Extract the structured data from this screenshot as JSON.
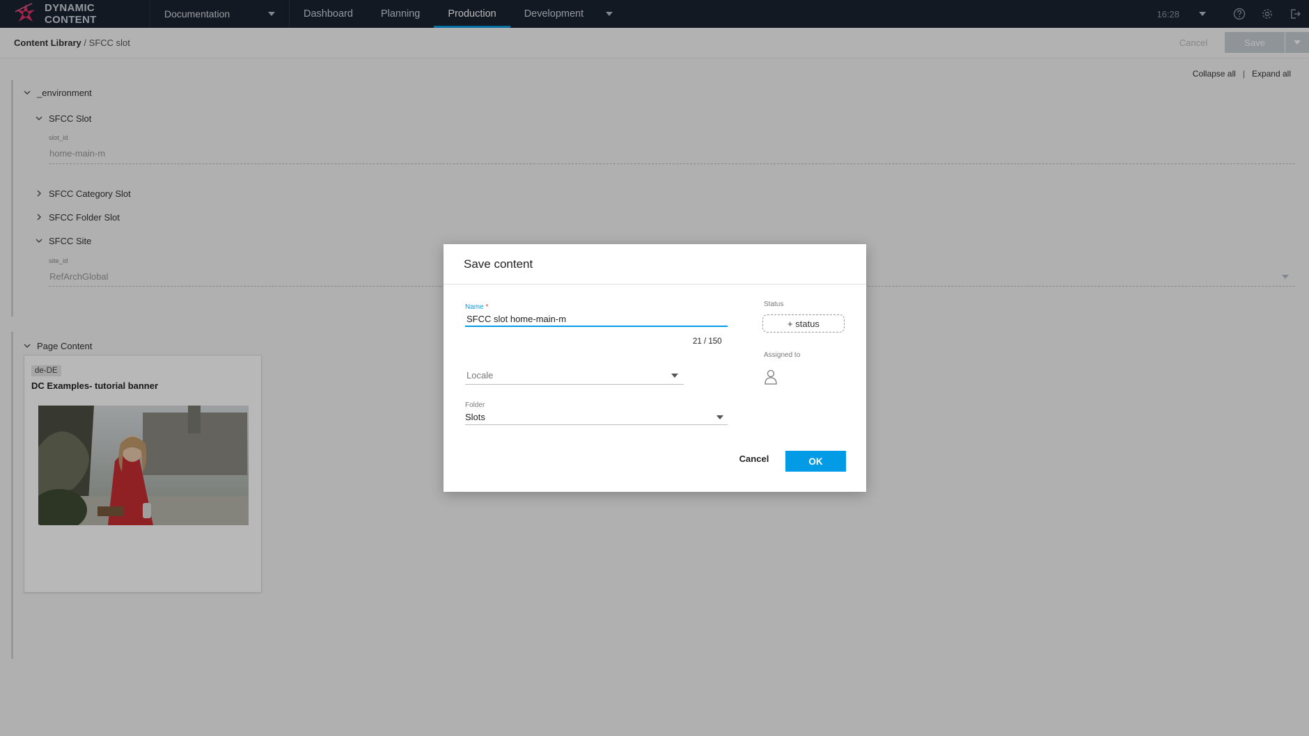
{
  "app": {
    "brand": "DYNAMIC CONTENT",
    "hub": "Documentation",
    "nav": [
      {
        "label": "Dashboard",
        "active": false
      },
      {
        "label": "Planning",
        "active": false
      },
      {
        "label": "Production",
        "active": true
      },
      {
        "label": "Development",
        "active": false
      }
    ],
    "clock": "16:28",
    "icons": [
      "help-icon",
      "settings-icon",
      "logout-icon"
    ]
  },
  "breadcrumb": {
    "root": "Content Library",
    "separator": "/",
    "leaf": "SFCC slot"
  },
  "toolbar": {
    "cancel_label": "Cancel",
    "save_label": "Save"
  },
  "content": {
    "collapse_all": "Collapse all",
    "expand_all": "Expand all",
    "environment": {
      "label": "_environment",
      "sfcc_slot": {
        "label": "SFCC Slot",
        "field_label": "slot_id",
        "field_value": "home-main-m"
      },
      "sfcc_category_slot": "SFCC Category Slot",
      "sfcc_folder_slot": "SFCC Folder Slot",
      "sfcc_site": {
        "label": "SFCC Site",
        "field_label": "site_id",
        "field_value": "RefArchGlobal"
      }
    },
    "page_content": {
      "label": "Page Content",
      "card": {
        "locale": "de-DE",
        "title": "DC Examples- tutorial banner"
      }
    }
  },
  "dialog": {
    "title": "Save content",
    "name_label": "Name",
    "required_mark": "*",
    "name_value": "SFCC slot home-main-m",
    "counter": "21 / 150",
    "locale_placeholder": "Locale",
    "folder_label": "Folder",
    "folder_value": "Slots",
    "status_label": "Status",
    "status_button": "+ status",
    "assigned_label": "Assigned to",
    "cancel_label": "Cancel",
    "ok_label": "OK"
  },
  "colors": {
    "topbar": "#1b2331",
    "accent": "#039be5",
    "required": "#e53935"
  }
}
